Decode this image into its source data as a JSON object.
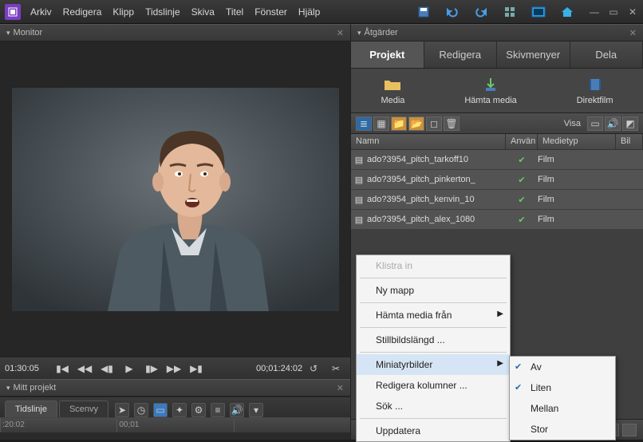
{
  "menu": {
    "arkiv": "Arkiv",
    "redigera": "Redigera",
    "klipp": "Klipp",
    "tidslinje": "Tidslinje",
    "skiva": "Skiva",
    "titel": "Titel",
    "fonster": "Fönster",
    "hjalp": "Hjälp"
  },
  "panels": {
    "monitor": "Monitor",
    "atgarder": "Åtgärder",
    "mitt_projekt": "Mitt projekt"
  },
  "tabs": {
    "projekt": "Projekt",
    "redigera": "Redigera",
    "skivmenyer": "Skivmenyer",
    "dela": "Dela",
    "tidslinje": "Tidslinje",
    "scenvy": "Scenvy"
  },
  "media_actions": {
    "media": "Media",
    "hamta": "Hämta media",
    "direkt": "Direktfilm"
  },
  "toolbar": {
    "visa": "Visa"
  },
  "columns": {
    "name": "Namn",
    "use": "Använ",
    "type": "Medietyp",
    "bil": "Bil"
  },
  "rows": [
    {
      "name": "ado?3954_pitch_tarkoff10",
      "type": "Film"
    },
    {
      "name": "ado?3954_pitch_pinkerton_",
      "type": "Film"
    },
    {
      "name": "ado?3954_pitch_kenvin_10",
      "type": "Film"
    },
    {
      "name": "ado?3954_pitch_alex_1080",
      "type": "Film"
    }
  ],
  "transport": {
    "tc_left": "01:30:05",
    "tc_right": "00;01:24:02"
  },
  "ruler": {
    "t0": ":20:02",
    "t1": "00;01"
  },
  "context_menu": {
    "paste": "Klistra in",
    "new_folder": "Ny mapp",
    "get_media_from": "Hämta media från",
    "still_duration": "Stillbildslängd ...",
    "thumbnails": "Miniatyrbilder",
    "edit_columns": "Redigera kolumner ...",
    "find": "Sök ...",
    "refresh": "Uppdatera"
  },
  "submenu": {
    "off": "Av",
    "small": "Liten",
    "medium": "Mellan",
    "large": "Stor"
  }
}
